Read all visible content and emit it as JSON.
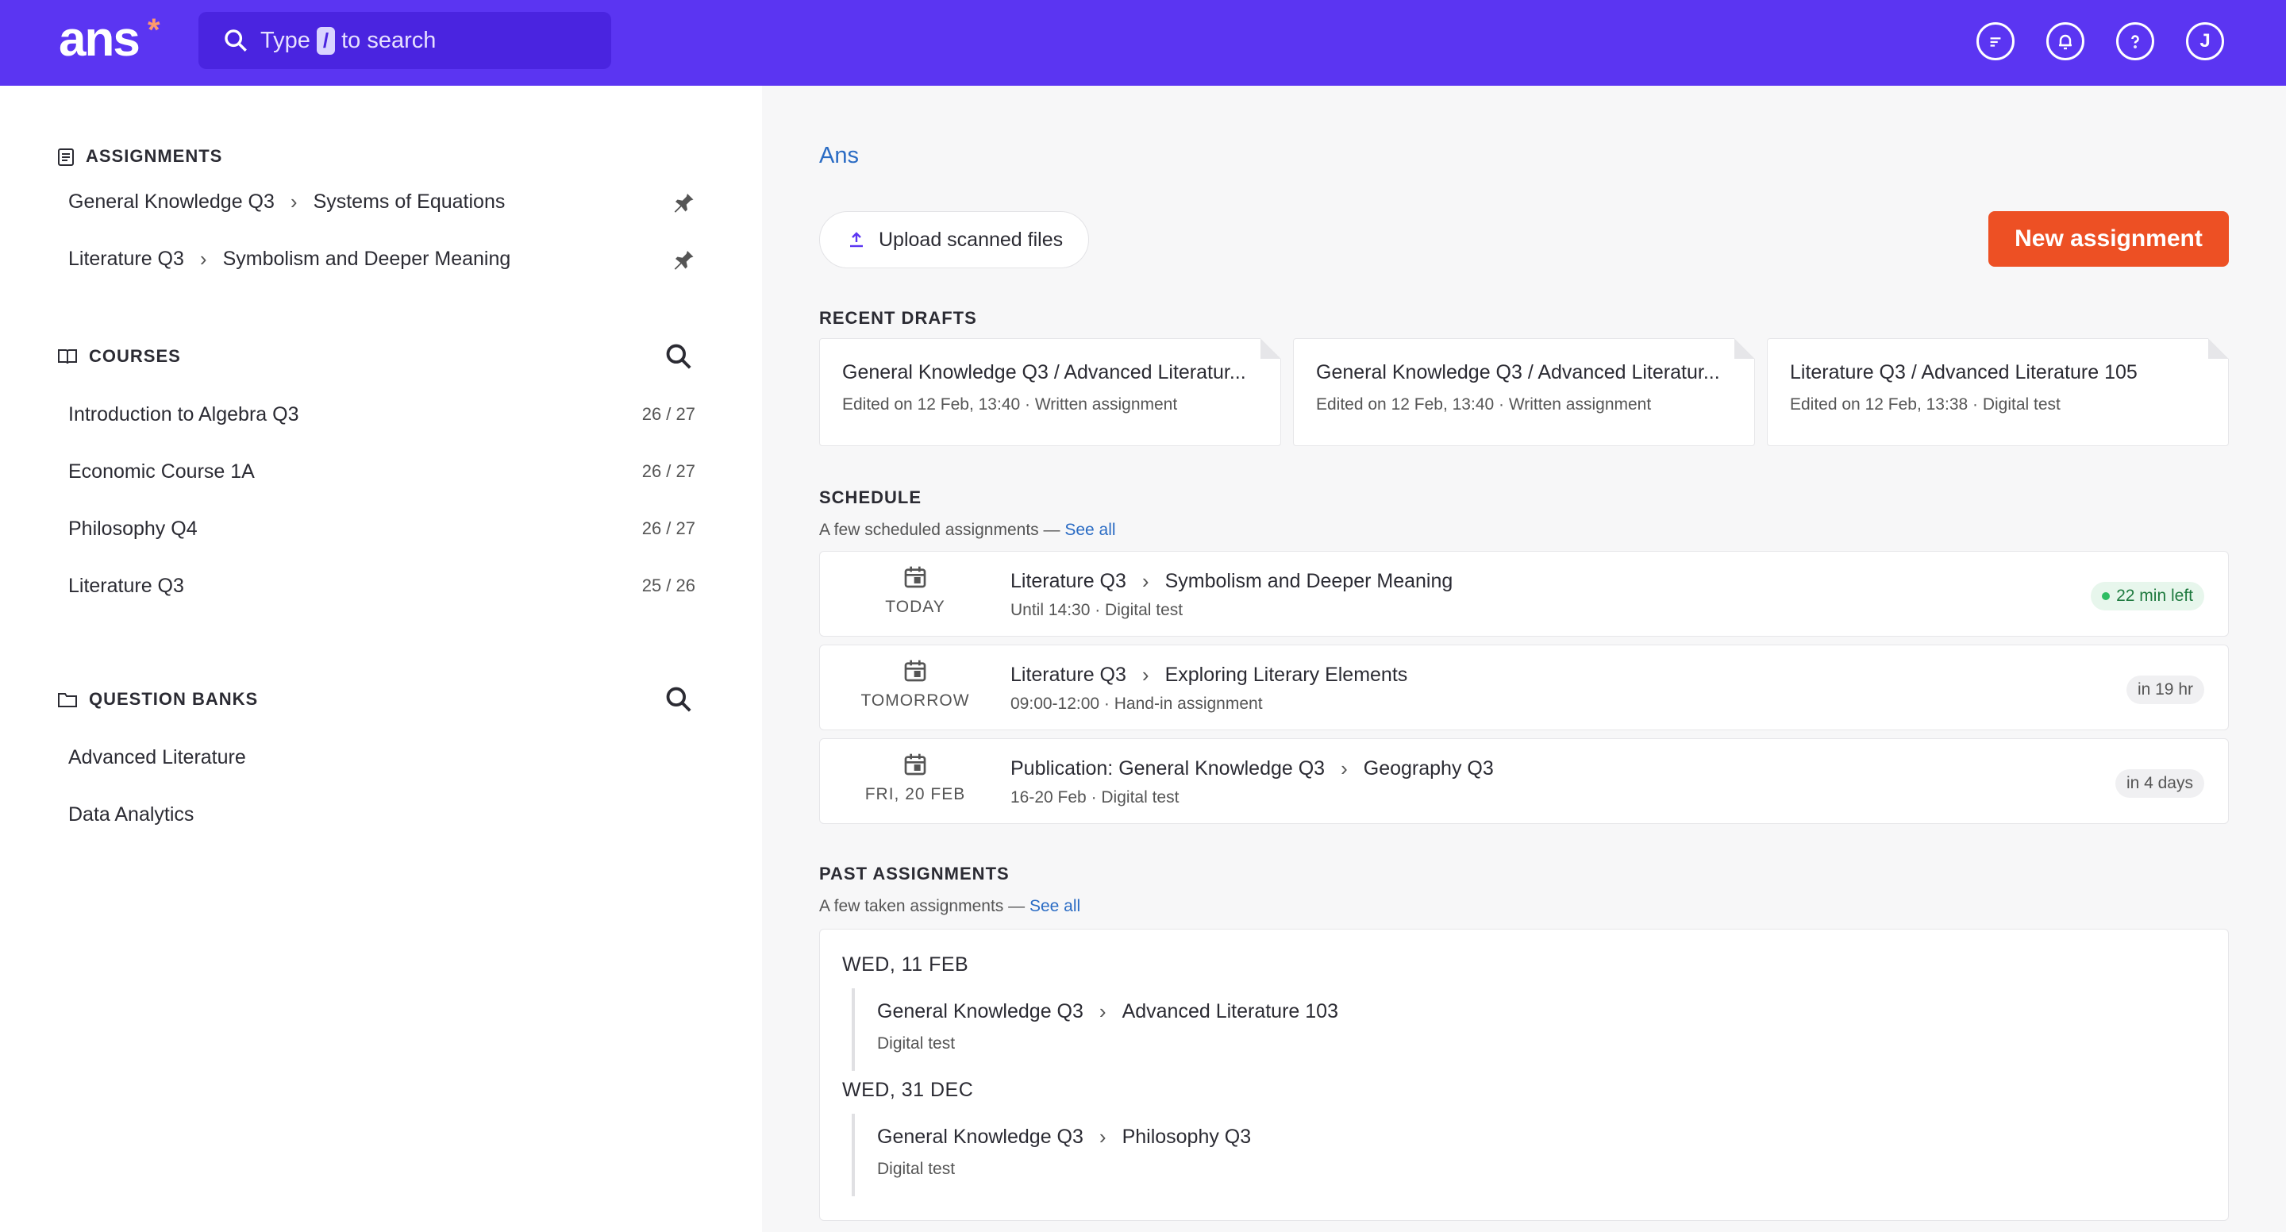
{
  "header": {
    "logo": "ans",
    "logo_mark": "*",
    "search_before": "Type",
    "search_key": "/",
    "search_after": "to search",
    "icons": [
      "feedback-icon",
      "bell-icon",
      "help-icon",
      "user-avatar"
    ],
    "avatar_initial": "J"
  },
  "sidebar": {
    "assignments_title": "ASSIGNMENTS",
    "assignments": [
      {
        "course": "General Knowledge Q3",
        "name": "Systems of Equations"
      },
      {
        "course": "Literature Q3",
        "name": "Symbolism and Deeper Meaning"
      }
    ],
    "courses_title": "COURSES",
    "courses": [
      {
        "name": "Introduction to Algebra Q3",
        "count": "26 / 27"
      },
      {
        "name": "Economic Course 1A",
        "count": "26 / 27"
      },
      {
        "name": "Philosophy Q4",
        "count": "26 / 27"
      },
      {
        "name": "Literature Q3",
        "count": "25 / 26"
      }
    ],
    "banks_title": "QUESTION BANKS",
    "banks": [
      "Advanced Literature",
      "Data Analytics"
    ]
  },
  "main": {
    "breadcrumb": "Ans",
    "upload_label": "Upload scanned files",
    "new_label": "New assignment",
    "drafts_title": "RECENT DRAFTS",
    "drafts": [
      {
        "title": "General Knowledge Q3 / Advanced Literatur...",
        "meta": "Edited on 12 Feb, 13:40 · Written assignment"
      },
      {
        "title": "General Knowledge Q3 / Advanced Literatur...",
        "meta": "Edited on 12 Feb, 13:40 · Written assignment"
      },
      {
        "title": "Literature Q3 / Advanced Literature 105",
        "meta": "Edited on 12 Feb, 13:38 · Digital test"
      }
    ],
    "schedule_title": "SCHEDULE",
    "schedule_sub": "A few scheduled assignments —",
    "see_all": "See all",
    "schedule": [
      {
        "date": "TODAY",
        "course": "Literature Q3",
        "name": "Symbolism and Deeper Meaning",
        "meta": "Until 14:30 · Digital test",
        "badge": "22 min left"
      },
      {
        "date": "TOMORROW",
        "course": "Literature Q3",
        "name": "Exploring Literary Elements",
        "meta": "09:00-12:00 · Hand-in assignment",
        "badge": "in 19 hr"
      },
      {
        "date": "FRI, 20 FEB",
        "course": "Publication: General Knowledge Q3",
        "name": "Geography Q3",
        "meta": "16-20 Feb · Digital test",
        "badge": "in 4 days"
      }
    ],
    "past_title": "PAST ASSIGNMENTS",
    "past_sub": "A few taken assignments —",
    "past": [
      {
        "date": "WED, 11 FEB",
        "course": "General Knowledge Q3",
        "name": "Advanced Literature 103",
        "meta": "Digital test"
      },
      {
        "date": "WED, 31 DEC",
        "course": "General Knowledge Q3",
        "name": "Philosophy Q3",
        "meta": "Digital test"
      }
    ]
  }
}
